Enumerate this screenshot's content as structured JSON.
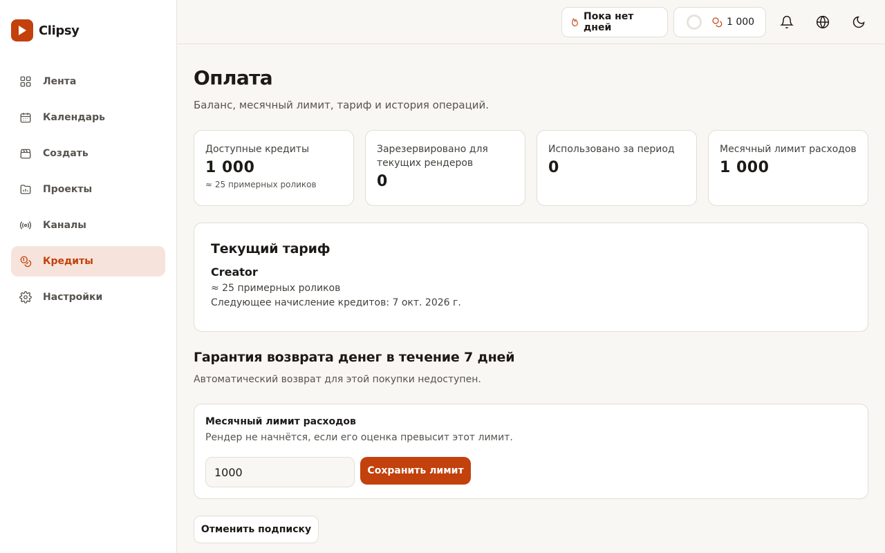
{
  "app": {
    "name": "Clipsy",
    "accent": "#c2410c"
  },
  "sidebar": {
    "items": [
      {
        "label": "Лента",
        "icon": "grid-icon",
        "active": false
      },
      {
        "label": "Календарь",
        "icon": "calendar-icon",
        "active": false
      },
      {
        "label": "Создать",
        "icon": "clapperboard-icon",
        "active": false
      },
      {
        "label": "Проекты",
        "icon": "folder-chart-icon",
        "active": false
      },
      {
        "label": "Каналы",
        "icon": "broadcast-icon",
        "active": false
      },
      {
        "label": "Кредиты",
        "icon": "coins-icon",
        "active": true
      },
      {
        "label": "Настройки",
        "icon": "gear-icon",
        "active": false
      }
    ]
  },
  "header": {
    "streak_label": "Пока нет дней",
    "credits_value": "1 000",
    "icons": [
      "flame-icon",
      "coins-icon",
      "bell-icon",
      "globe-icon",
      "moon-icon"
    ]
  },
  "page": {
    "title": "Оплата",
    "subtitle": "Баланс, месячный лимит, тариф и история операций."
  },
  "stats": [
    {
      "label": "Доступные кредиты",
      "value": "1 000",
      "note": "≈ 25 примерных роликов"
    },
    {
      "label": "Зарезервировано для текущих рендеров",
      "value": "0",
      "note": ""
    },
    {
      "label": "Использовано за период",
      "value": "0",
      "note": ""
    },
    {
      "label": "Месячный лимит расходов",
      "value": "1 000",
      "note": ""
    }
  ],
  "plan": {
    "title": "Текущий тариф",
    "name": "Creator",
    "estimate": "≈ 25 примерных роликов",
    "next_credit": "Следующее начисление кредитов: 7 окт. 2026 г."
  },
  "refund": {
    "title": "Гарантия возврата денег в течение 7 дней",
    "note": "Автоматический возврат для этой покупки недоступен."
  },
  "limit": {
    "title": "Месячный лимит расходов",
    "description": "Рендер не начнётся, если его оценка превысит этот лимит.",
    "value": "1000",
    "save_label": "Сохранить лимит"
  },
  "cancel_label": "Отменить подписку"
}
